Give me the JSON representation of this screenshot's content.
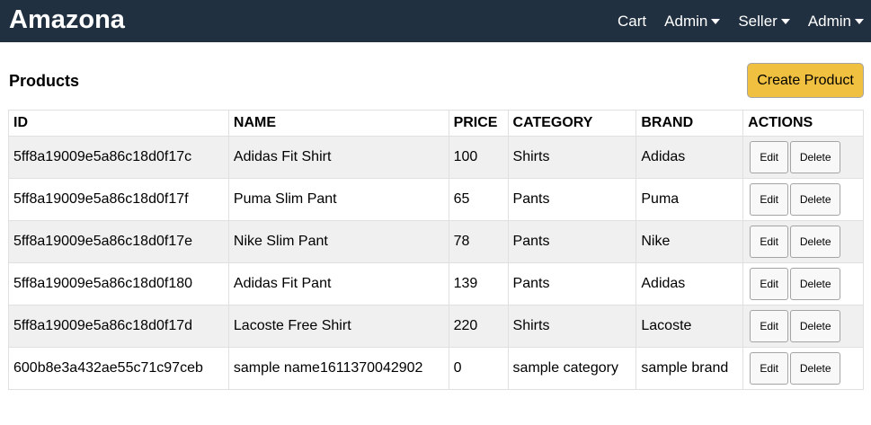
{
  "header": {
    "brand": "Amazona",
    "nav": [
      {
        "label": "Cart",
        "dropdown": false
      },
      {
        "label": "Admin",
        "dropdown": true
      },
      {
        "label": "Seller",
        "dropdown": true
      },
      {
        "label": "Admin",
        "dropdown": true
      }
    ]
  },
  "page": {
    "title": "Products",
    "create_label": "Create Product"
  },
  "table": {
    "columns": [
      "ID",
      "NAME",
      "PRICE",
      "CATEGORY",
      "BRAND",
      "ACTIONS"
    ],
    "rows": [
      {
        "id": "5ff8a19009e5a86c18d0f17c",
        "name": "Adidas Fit Shirt",
        "price": "100",
        "category": "Shirts",
        "brand": "Adidas"
      },
      {
        "id": "5ff8a19009e5a86c18d0f17f",
        "name": "Puma Slim Pant",
        "price": "65",
        "category": "Pants",
        "brand": "Puma"
      },
      {
        "id": "5ff8a19009e5a86c18d0f17e",
        "name": "Nike Slim Pant",
        "price": "78",
        "category": "Pants",
        "brand": "Nike"
      },
      {
        "id": "5ff8a19009e5a86c18d0f180",
        "name": "Adidas Fit Pant",
        "price": "139",
        "category": "Pants",
        "brand": "Adidas"
      },
      {
        "id": "5ff8a19009e5a86c18d0f17d",
        "name": "Lacoste Free Shirt",
        "price": "220",
        "category": "Shirts",
        "brand": "Lacoste"
      },
      {
        "id": "600b8e3a432ae55c71c97ceb",
        "name": "sample name1611370042902",
        "price": "0",
        "category": "sample category",
        "brand": "sample brand"
      }
    ],
    "edit_label": "Edit",
    "delete_label": "Delete"
  },
  "colors": {
    "navbar": "#203040",
    "create_button": "#f0c040",
    "row_stripe": "#f0f0f0"
  }
}
